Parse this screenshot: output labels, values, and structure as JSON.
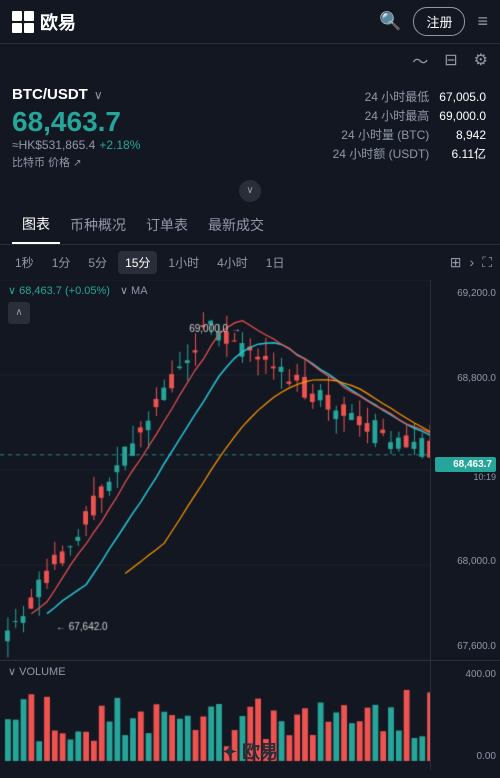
{
  "header": {
    "logo_text": "欧易",
    "register_label": "注册",
    "menu_label": "≡"
  },
  "ticker": {
    "pair": "BTC/USDT",
    "price": "68,463.7",
    "hkd_price": "≈HK$531,865.4",
    "change_pct": "+2.18%",
    "bitcoin_label": "比特币 价格",
    "stats": [
      {
        "label": "24 小时最低",
        "value": "67,005.0"
      },
      {
        "label": "24 小时最高",
        "value": "69,000.0"
      },
      {
        "label": "24 小时量 (BTC)",
        "value": "8,942"
      },
      {
        "label": "24 小时额 (USDT)",
        "value": "6.11亿"
      }
    ]
  },
  "tabs": [
    {
      "id": "chart",
      "label": "图表",
      "active": true
    },
    {
      "id": "overview",
      "label": "币种概况",
      "active": false
    },
    {
      "id": "orderbook",
      "label": "订单表",
      "active": false
    },
    {
      "id": "trades",
      "label": "最新成交",
      "active": false
    }
  ],
  "time_buttons": [
    {
      "label": "1秒",
      "active": false
    },
    {
      "label": "1分",
      "active": false
    },
    {
      "label": "5分",
      "active": false
    },
    {
      "label": "15分",
      "active": true
    },
    {
      "label": "1小时",
      "active": false
    },
    {
      "label": "4小时",
      "active": false
    },
    {
      "label": "1日",
      "active": false
    }
  ],
  "chart": {
    "price_display": "68,463.7 (+0.05%)",
    "ma_label": "MA",
    "expand_icon": "∧",
    "y_labels": [
      "69,200.0",
      "68,800.0",
      "",
      "68,000.0",
      "67,600.0"
    ],
    "current_price_tag": "68,463.7",
    "current_time_tag": "10:19",
    "annotation_high": "69,000.0 →",
    "annotation_low": "← 67,642.0",
    "dashed_line_price": "68,463.7"
  },
  "volume": {
    "label": "∨ VOLUME",
    "y_labels": [
      "400.00",
      "",
      "0.00"
    ]
  },
  "watermark": "✦ 欧易"
}
